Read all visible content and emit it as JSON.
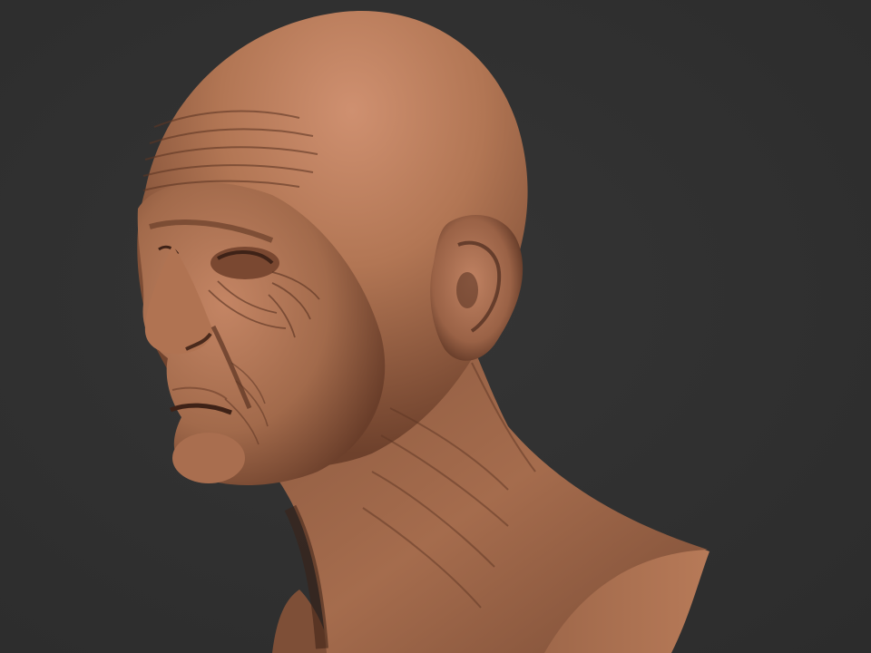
{
  "scene": {
    "subject": "sculpted-head-bust",
    "colors": {
      "background": "#303030",
      "clay_base": "#a46a4c",
      "clay_highlight": "#c98a66",
      "clay_shadow": "#4a2a1c",
      "crease": "#5e3624"
    }
  }
}
